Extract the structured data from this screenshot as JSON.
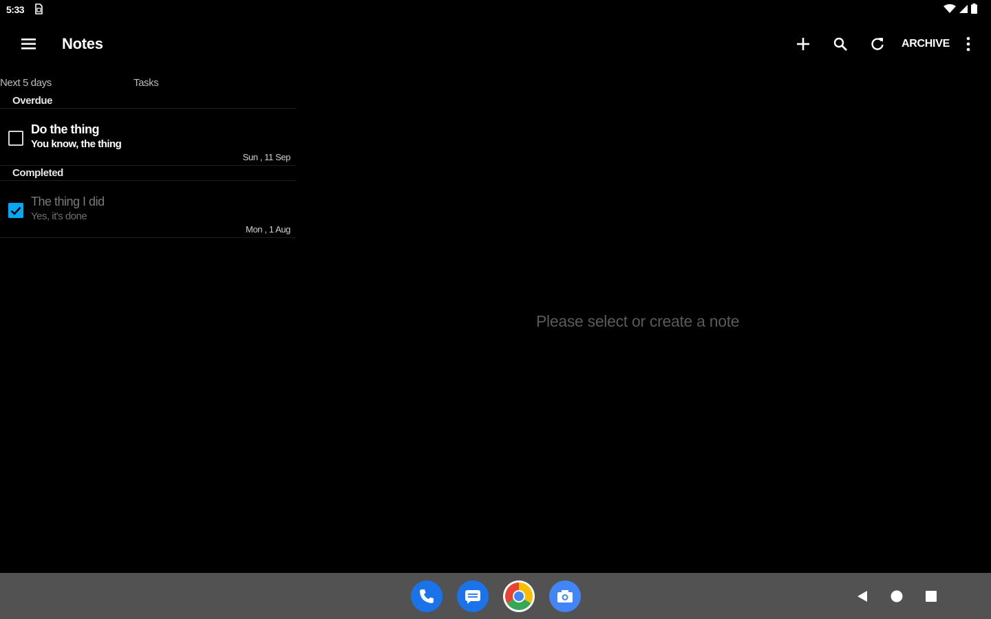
{
  "status_bar": {
    "time": "5:33",
    "icons": [
      "sim-card-icon",
      "wifi-icon",
      "cellular-signal-icon",
      "battery-icon"
    ]
  },
  "toolbar": {
    "menu_icon": "hamburger-menu-icon",
    "title": "Notes",
    "add_icon": "plus-icon",
    "search_icon": "search-icon",
    "sync_icon": "refresh-icon",
    "archive_label": "ARCHIVE",
    "more_icon": "more-vertical-icon"
  },
  "tabs": [
    {
      "label": "Next 5 days"
    },
    {
      "label": "Tasks"
    }
  ],
  "sections": [
    {
      "header": "Overdue",
      "items": [
        {
          "title": "Do the thing",
          "subtitle": "You know, the thing",
          "date": "Sun , 11 Sep",
          "checked": false
        }
      ]
    },
    {
      "header": "Completed",
      "items": [
        {
          "title": "The thing I did",
          "subtitle": "Yes, it's done",
          "date": "Mon , 1 Aug",
          "checked": true
        }
      ]
    }
  ],
  "detail": {
    "placeholder": "Please select or create a note"
  },
  "nav_bar": {
    "dock": [
      "phone-icon",
      "messages-icon",
      "chrome-icon",
      "camera-icon"
    ],
    "buttons": [
      "back-icon",
      "home-icon",
      "recents-icon"
    ]
  },
  "colors": {
    "background": "#000000",
    "accent": "#03a9f4",
    "nav_bar": "#525252"
  }
}
